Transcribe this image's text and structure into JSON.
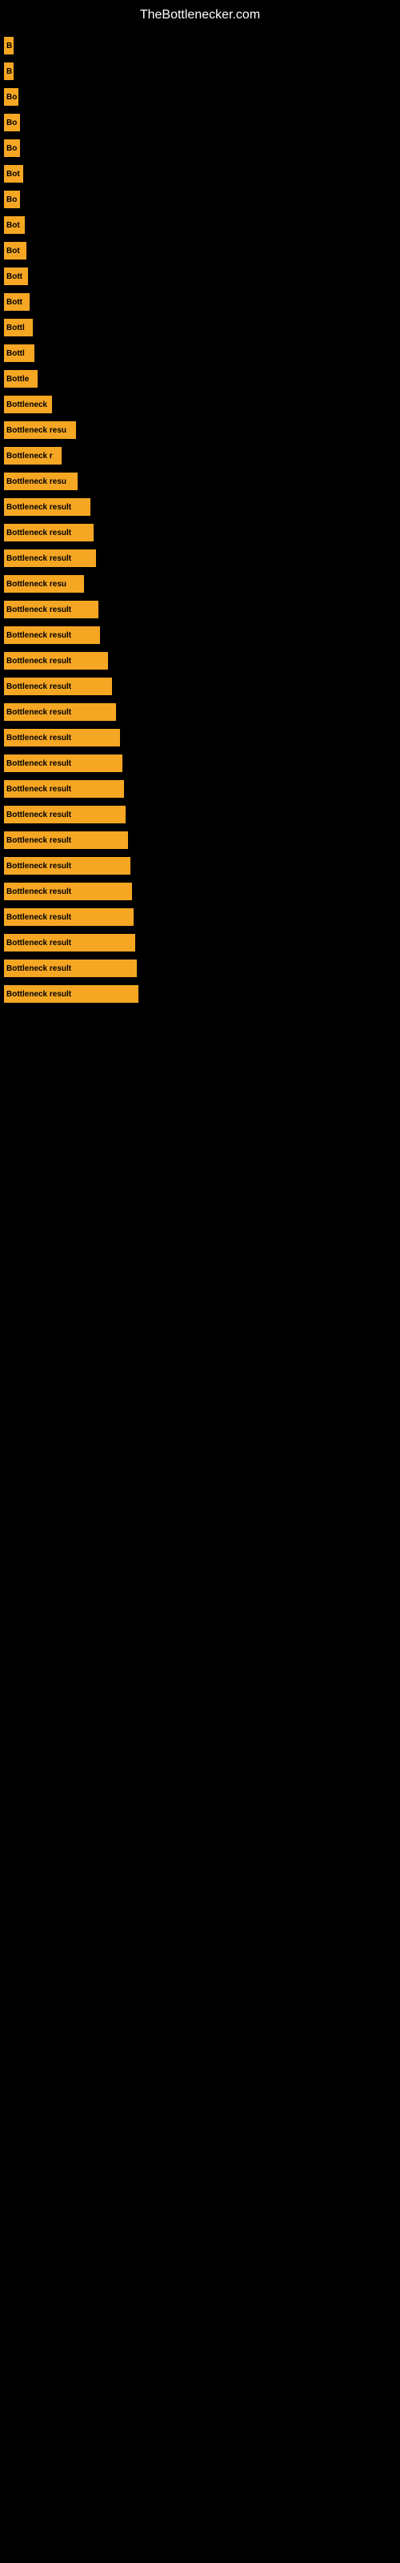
{
  "site": {
    "title": "TheBottlenecker.com"
  },
  "bars": [
    {
      "label": "B",
      "width": 12
    },
    {
      "label": "B",
      "width": 12
    },
    {
      "label": "Bo",
      "width": 18
    },
    {
      "label": "Bo",
      "width": 20
    },
    {
      "label": "Bo",
      "width": 20
    },
    {
      "label": "Bot",
      "width": 24
    },
    {
      "label": "Bo",
      "width": 20
    },
    {
      "label": "Bot",
      "width": 26
    },
    {
      "label": "Bot",
      "width": 28
    },
    {
      "label": "Bott",
      "width": 30
    },
    {
      "label": "Bott",
      "width": 32
    },
    {
      "label": "Bottl",
      "width": 36
    },
    {
      "label": "Bottl",
      "width": 38
    },
    {
      "label": "Bottle",
      "width": 42
    },
    {
      "label": "Bottleneck",
      "width": 60
    },
    {
      "label": "Bottleneck resu",
      "width": 90
    },
    {
      "label": "Bottleneck r",
      "width": 72
    },
    {
      "label": "Bottleneck resu",
      "width": 92
    },
    {
      "label": "Bottleneck result",
      "width": 108
    },
    {
      "label": "Bottleneck result",
      "width": 112
    },
    {
      "label": "Bottleneck result",
      "width": 115
    },
    {
      "label": "Bottleneck resu",
      "width": 100
    },
    {
      "label": "Bottleneck result",
      "width": 118
    },
    {
      "label": "Bottleneck result",
      "width": 120
    },
    {
      "label": "Bottleneck result",
      "width": 130
    },
    {
      "label": "Bottleneck result",
      "width": 135
    },
    {
      "label": "Bottleneck result",
      "width": 140
    },
    {
      "label": "Bottleneck result",
      "width": 145
    },
    {
      "label": "Bottleneck result",
      "width": 148
    },
    {
      "label": "Bottleneck result",
      "width": 150
    },
    {
      "label": "Bottleneck result",
      "width": 152
    },
    {
      "label": "Bottleneck result",
      "width": 155
    },
    {
      "label": "Bottleneck result",
      "width": 158
    },
    {
      "label": "Bottleneck result",
      "width": 160
    },
    {
      "label": "Bottleneck result",
      "width": 162
    },
    {
      "label": "Bottleneck result",
      "width": 164
    },
    {
      "label": "Bottleneck result",
      "width": 166
    },
    {
      "label": "Bottleneck result",
      "width": 168
    }
  ]
}
